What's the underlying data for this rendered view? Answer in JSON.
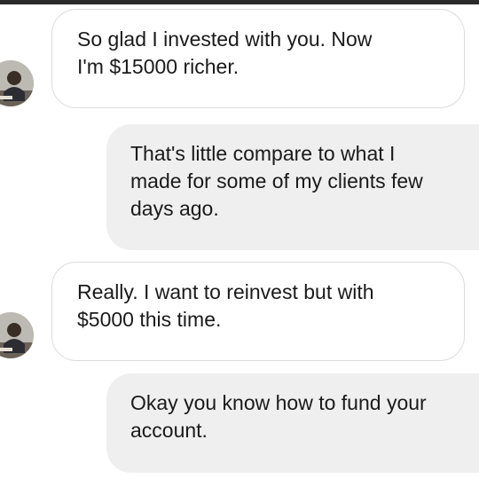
{
  "conversation": {
    "messages": [
      {
        "sender": "contact",
        "text": "So glad I invested with you. Now\nI'm $15000 richer."
      },
      {
        "sender": "me",
        "text": "That's little compare to what I\nmade for some of my clients few\ndays ago."
      },
      {
        "sender": "contact",
        "text": "Really. I want to reinvest but with\n$5000 this time."
      },
      {
        "sender": "me",
        "text": "Okay you know how to fund your\naccount."
      }
    ]
  },
  "colors": {
    "incoming_bubble": "#ffffff",
    "incoming_border": "#dcdcdc",
    "outgoing_bubble": "#efefef",
    "text": "#1a1a1a"
  }
}
